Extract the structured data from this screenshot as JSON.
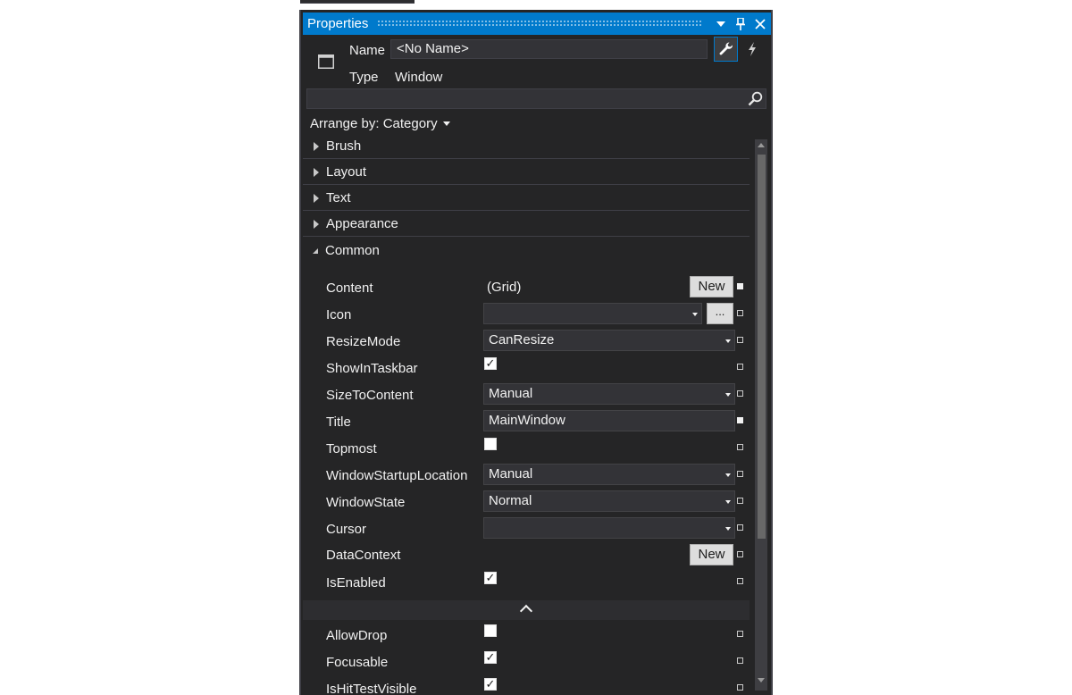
{
  "panel": {
    "title": "Properties",
    "name_label": "Name",
    "name_value": "<No Name>",
    "type_label": "Type",
    "type_value": "Window",
    "search_placeholder": "",
    "arrange_by": "Arrange by: Category"
  },
  "categories": [
    {
      "label": "Brush",
      "expanded": false
    },
    {
      "label": "Layout",
      "expanded": false
    },
    {
      "label": "Text",
      "expanded": false
    },
    {
      "label": "Appearance",
      "expanded": false
    },
    {
      "label": "Common",
      "expanded": true
    }
  ],
  "properties": {
    "content": {
      "label": "Content",
      "value": "(Grid)",
      "button": "New"
    },
    "icon": {
      "label": "Icon",
      "value": "",
      "button": "..."
    },
    "resize_mode": {
      "label": "ResizeMode",
      "value": "CanResize"
    },
    "show_in_taskbar": {
      "label": "ShowInTaskbar",
      "checked": true
    },
    "size_to_content": {
      "label": "SizeToContent",
      "value": "Manual"
    },
    "title": {
      "label": "Title",
      "value": "MainWindow"
    },
    "topmost": {
      "label": "Topmost",
      "checked": false
    },
    "window_startup_location": {
      "label": "WindowStartupLocation",
      "value": "Manual"
    },
    "window_state": {
      "label": "WindowState",
      "value": "Normal"
    },
    "cursor": {
      "label": "Cursor",
      "value": ""
    },
    "data_context": {
      "label": "DataContext",
      "button": "New"
    },
    "is_enabled": {
      "label": "IsEnabled",
      "checked": true
    },
    "allow_drop": {
      "label": "AllowDrop",
      "checked": false
    },
    "focusable": {
      "label": "Focusable",
      "checked": true
    },
    "is_hit_test_visible": {
      "label": "IsHitTestVisible",
      "checked": true
    }
  },
  "checkmark": "✓",
  "colors": {
    "accent": "#007acc",
    "panel_bg": "#252526",
    "input_bg": "#333337",
    "text": "#f1f1f1"
  }
}
